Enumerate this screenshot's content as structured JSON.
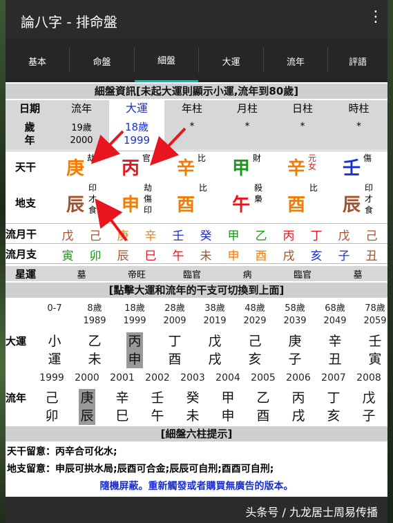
{
  "app": {
    "title": "論八字 - 排命盤"
  },
  "tabs": [
    "基本",
    "命盤",
    "細盤",
    "大運",
    "流年",
    "評語"
  ],
  "selected_tab": "細盤",
  "section1_title": "細盤資訊[未起大運則顯示小運,流年到80歲]",
  "col_headers": [
    "日期",
    "流年",
    "大運",
    "年柱",
    "月柱",
    "日柱",
    "時柱"
  ],
  "age_row": {
    "label": "歲年",
    "label_a": "歲",
    "label_b": "年",
    "liunian": [
      "19歲",
      "2000"
    ],
    "dayun": [
      "18歲",
      "1999"
    ],
    "stars": [
      "*",
      "*",
      "*",
      "*"
    ]
  },
  "tiangan": {
    "label": "天干",
    "cells": [
      {
        "char": "庚",
        "color": "#f57c00",
        "sub": [
          "劫"
        ]
      },
      {
        "char": "丙",
        "color": "#e8141e",
        "sub": [
          "官"
        ]
      },
      {
        "char": "辛",
        "color": "#f57c00",
        "sub": [
          "比"
        ]
      },
      {
        "char": "甲",
        "color": "#1a9a1a",
        "sub": [
          "財"
        ]
      },
      {
        "char": "辛",
        "color": "#f57c00",
        "sub": [
          "元",
          "女"
        ],
        "subcolor": "#e8141e"
      },
      {
        "char": "壬",
        "color": "#1a2fd0",
        "sub": [
          "傷"
        ]
      }
    ]
  },
  "dizhi": {
    "label": "地支",
    "cells": [
      {
        "char": "辰",
        "color": "#a0522d",
        "sub": [
          "印",
          "才",
          "食"
        ]
      },
      {
        "char": "申",
        "color": "#f57c00",
        "sub": [
          "劫",
          "傷",
          "印"
        ]
      },
      {
        "char": "酉",
        "color": "#f57c00",
        "sub": [
          "比"
        ]
      },
      {
        "char": "午",
        "color": "#e8141e",
        "sub": [
          "殺",
          "梟"
        ]
      },
      {
        "char": "酉",
        "color": "#f57c00",
        "sub": [
          "比"
        ]
      },
      {
        "char": "辰",
        "color": "#a0522d",
        "sub": [
          "印",
          "才",
          "食"
        ]
      }
    ]
  },
  "liuyuegan": {
    "label": "流月干",
    "items": [
      {
        "c": "戊",
        "color": "#a0522d"
      },
      {
        "c": "己",
        "color": "#a0522d"
      },
      {
        "c": "庚",
        "color": "#f57c00"
      },
      {
        "c": "辛",
        "color": "#f57c00"
      },
      {
        "c": "壬",
        "color": "#1a2fd0"
      },
      {
        "c": "癸",
        "color": "#1a2fd0"
      },
      {
        "c": "甲",
        "color": "#1a9a1a"
      },
      {
        "c": "乙",
        "color": "#1a9a1a"
      },
      {
        "c": "丙",
        "color": "#e8141e"
      },
      {
        "c": "丁",
        "color": "#e8141e"
      },
      {
        "c": "戊",
        "color": "#a0522d"
      },
      {
        "c": "己",
        "color": "#a0522d"
      }
    ]
  },
  "liuyuezhi": {
    "label": "流月支",
    "items": [
      {
        "c": "寅",
        "color": "#1a9a1a"
      },
      {
        "c": "卯",
        "color": "#1a9a1a"
      },
      {
        "c": "辰",
        "color": "#a0522d"
      },
      {
        "c": "巳",
        "color": "#e8141e"
      },
      {
        "c": "午",
        "color": "#e8141e"
      },
      {
        "c": "未",
        "color": "#a0522d"
      },
      {
        "c": "申",
        "color": "#f57c00"
      },
      {
        "c": "酉",
        "color": "#f57c00"
      },
      {
        "c": "戌",
        "color": "#a0522d"
      },
      {
        "c": "亥",
        "color": "#1a2fd0"
      },
      {
        "c": "子",
        "color": "#1a2fd0"
      },
      {
        "c": "丑",
        "color": "#a0522d"
      }
    ]
  },
  "xingyun": {
    "label": "星運",
    "items": [
      "墓",
      "帝旺",
      "臨官",
      "病",
      "臨官",
      "墓"
    ]
  },
  "section2_title": "[點擊大運和流年的干支可切換到上面]",
  "dayun": {
    "label": "大運",
    "ages": [
      "0-7",
      "8歲",
      "18歲",
      "28歲",
      "38歲",
      "48歲",
      "58歲",
      "68歲",
      "78歲"
    ],
    "years": [
      "",
      "1989",
      "1999",
      "2009",
      "2019",
      "2029",
      "2039",
      "2049",
      "2059"
    ],
    "top": [
      "小",
      "乙",
      "丙",
      "丁",
      "戊",
      "己",
      "庚",
      "辛",
      "壬"
    ],
    "bottom": [
      "運",
      "未",
      "申",
      "酉",
      "戌",
      "亥",
      "子",
      "丑",
      "寅"
    ],
    "selected_index": 2
  },
  "liunian": {
    "label": "流年",
    "years": [
      "1999",
      "2000",
      "2001",
      "2002",
      "2003",
      "2004",
      "2005",
      "2006",
      "2007",
      "2008"
    ],
    "top": [
      "己",
      "庚",
      "辛",
      "壬",
      "癸",
      "甲",
      "乙",
      "丙",
      "丁",
      "戊"
    ],
    "bottom": [
      "卯",
      "辰",
      "巳",
      "午",
      "未",
      "申",
      "酉",
      "戌",
      "亥",
      "子"
    ],
    "selected_index": 1
  },
  "section3_title": "[細盤六柱提示]",
  "notes": [
    "天干留意：丙辛合可化水;",
    "地支留意：申辰可拱水局;辰酉可合金;辰辰可自刑;酉酉可自刑;"
  ],
  "ad_text": "隨機屏蔽。重新觸發或者購買無廣告的版本。",
  "watermark": "头条号 / 九龙居士周易传播"
}
